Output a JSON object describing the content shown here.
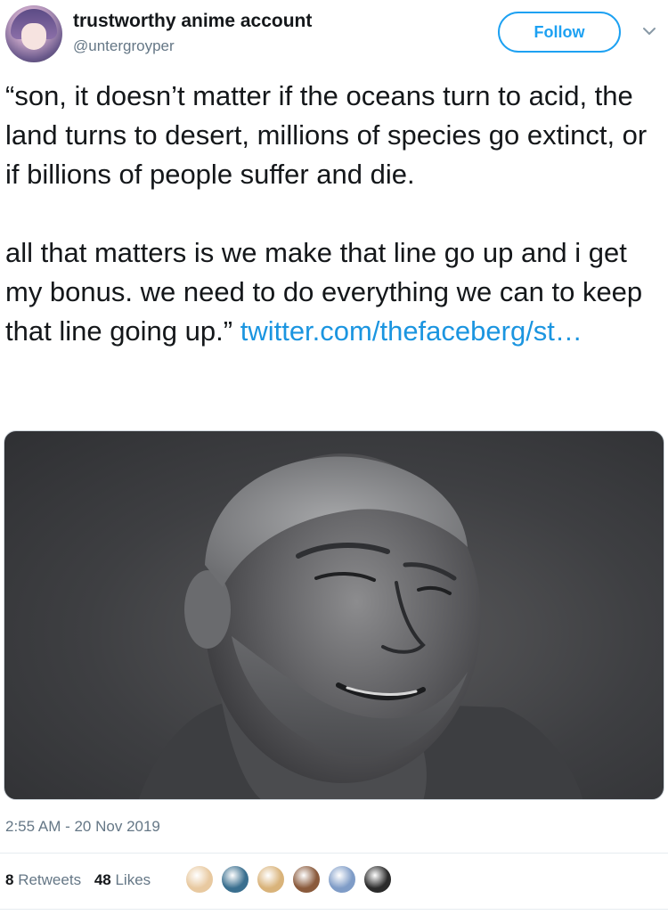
{
  "user": {
    "name": "trustworthy anime account",
    "handle": "@untergroyper"
  },
  "follow_label": "Follow",
  "tweet": {
    "paragraph1": "“son, it doesn’t matter if the oceans turn to acid, the land turns to desert, millions of species go extinct, or if billions of people suffer and die.",
    "paragraph2": "all that matters is we make that line go up and i get my bonus. we need to do everything we can to keep that line going up.”",
    "link": "twitter.com/thefaceberg/st…"
  },
  "timestamp": "2:55 AM - 20 Nov 2019",
  "stats": {
    "retweets_count": "8",
    "retweets_label": "Retweets",
    "likes_count": "48",
    "likes_label": "Likes"
  },
  "likers": [
    {
      "color": "#e8c9a0"
    },
    {
      "color": "#3a6f8f"
    },
    {
      "color": "#d9b37a"
    },
    {
      "color": "#8a5a3c"
    },
    {
      "color": "#7f9cc7"
    },
    {
      "color": "#2b2b2b"
    }
  ],
  "colors": {
    "accent": "#1da1f2",
    "link": "#1b95e0",
    "muted": "#657786",
    "text": "#14171a"
  }
}
